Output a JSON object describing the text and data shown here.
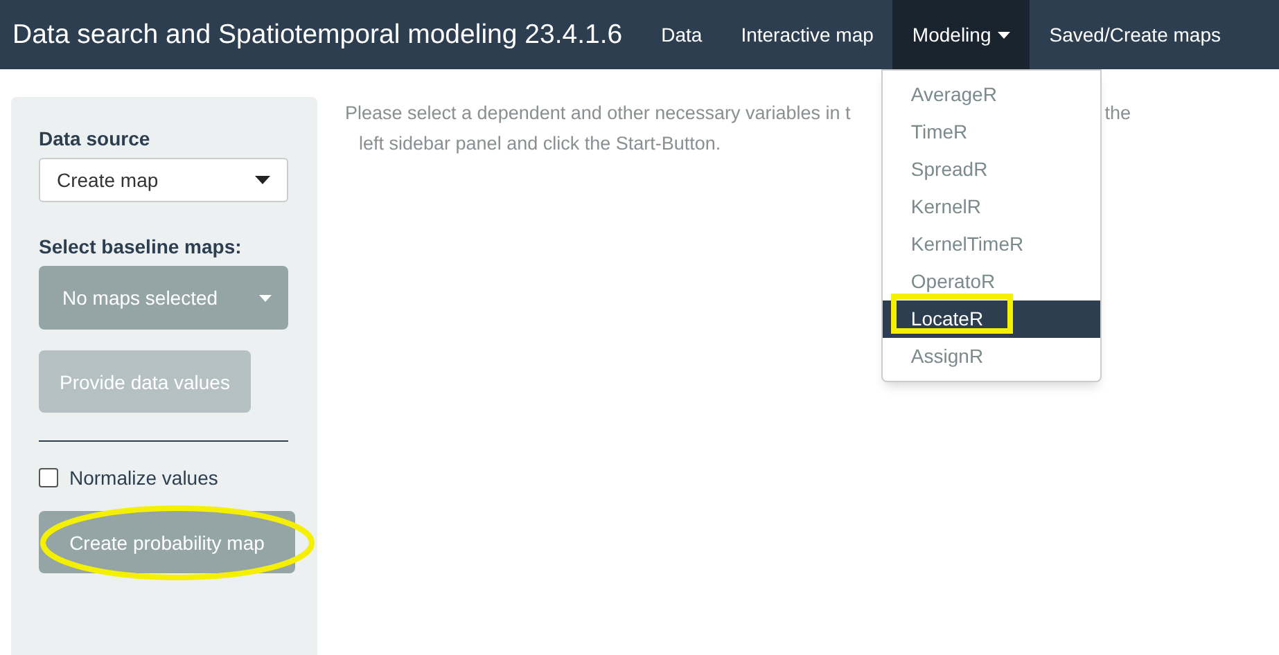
{
  "navbar": {
    "brand": "Data search and Spatiotemporal modeling 23.4.1.6",
    "items": [
      {
        "label": "Data",
        "dropdown": false,
        "open": false
      },
      {
        "label": "Interactive map",
        "dropdown": false,
        "open": false
      },
      {
        "label": "Modeling",
        "dropdown": true,
        "open": true
      },
      {
        "label": "Saved/Create maps",
        "dropdown": false,
        "open": false
      }
    ]
  },
  "menu": {
    "items": [
      {
        "label": "AverageR",
        "selected": false,
        "highlighted": false
      },
      {
        "label": "TimeR",
        "selected": false,
        "highlighted": false
      },
      {
        "label": "SpreadR",
        "selected": false,
        "highlighted": false
      },
      {
        "label": "KernelR",
        "selected": false,
        "highlighted": false
      },
      {
        "label": "KernelTimeR",
        "selected": false,
        "highlighted": false
      },
      {
        "label": "OperatoR",
        "selected": false,
        "highlighted": false
      },
      {
        "label": "LocateR",
        "selected": true,
        "highlighted": true
      },
      {
        "label": "AssignR",
        "selected": false,
        "highlighted": false
      }
    ]
  },
  "sidebar": {
    "data_source": {
      "label": "Data source",
      "value": "Create map"
    },
    "baseline": {
      "label": "Select baseline maps:",
      "value": "No maps selected"
    },
    "provide_button": {
      "label": "Provide data values",
      "disabled": true
    },
    "normalize": {
      "label": "Normalize values",
      "checked": false
    },
    "create_button": {
      "label": "Create probability map",
      "disabled": false,
      "highlighted": true
    }
  },
  "message": {
    "line_1_start": "Please select a dependent and other necessary variables in t",
    "line_1_end": "the",
    "line_2": "left sidebar panel and click the Start-Button."
  }
}
